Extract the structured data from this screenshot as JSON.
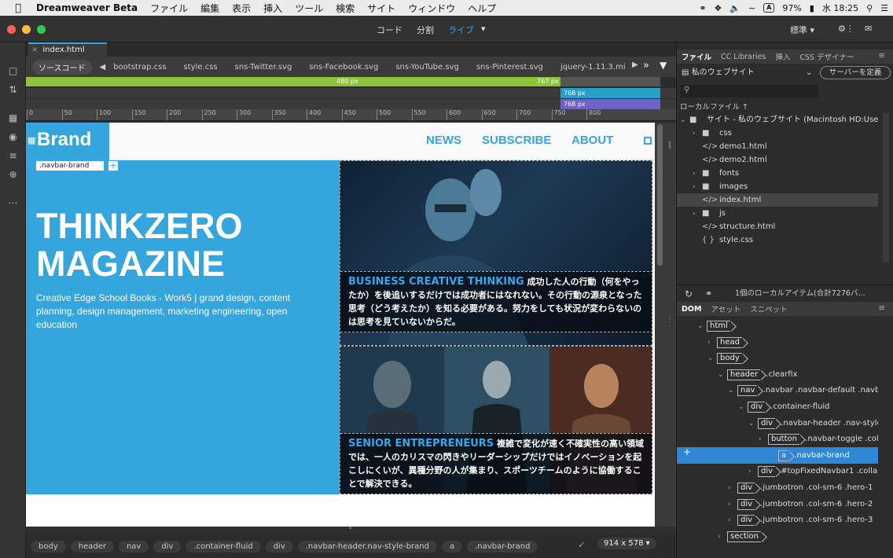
{
  "menubar": {
    "app": "Dreamweaver Beta",
    "items": [
      "ファイル",
      "編集",
      "表示",
      "挿入",
      "ツール",
      "検索",
      "サイト",
      "ウィンドウ",
      "ヘルプ"
    ],
    "battery": "97%",
    "clock": "水 18:25",
    "input_icon": "A"
  },
  "titlebar": {
    "views": [
      "コード",
      "分割",
      "ライブ"
    ],
    "workspace": "標準"
  },
  "doc": {
    "tab": "index.html"
  },
  "related": {
    "source": "ソースコード",
    "files": [
      "bootstrap.css",
      "style.css",
      "sns-Twitter.svg",
      "sns-Facebook.svg",
      "sns-YouTube.svg",
      "sns-Pinterest.svg",
      "jquery-1.11.3.mi"
    ]
  },
  "mq": {
    "a": "480",
    "a2": "767",
    "b": "768",
    "c": "768",
    "unit": "px"
  },
  "ruler": [
    "0",
    "50",
    "100",
    "150",
    "200",
    "250",
    "300",
    "350",
    "400",
    "450",
    "500",
    "550",
    "600",
    "650",
    "700",
    "750",
    "800"
  ],
  "page": {
    "brand": "Brand",
    "nav": [
      "NEWS",
      "SUBSCRIBE",
      "ABOUT"
    ],
    "selected_label": ".navbar-brand",
    "hero_title": "THINKZERO MAGAZINE",
    "hero_text": "Creative Edge School Books - Work5 | grand design, content planning, design management, marketing engineering, open education",
    "cap1_head": "BUSINESS CREATIVE THINKING",
    "cap1_body": "成功した人の行動（何をやったか）を後追いするだけでは成功者にはなれない。その行動の源泉となった思考（どう考えたか）を知る必要がある。努力をしても状況が変わらないのは思考を見ていないからだ。",
    "cap2_head": "SENIOR ENTREPRENEURS",
    "cap2_body": "複雑で変化が速く不確実性の高い領域では、一人のカリスマの閃きやリーダーシップだけではイノベーションを起こしにくいが、異種分野の人が集まり、スポーツチームのように協働することで解決できる。"
  },
  "status": {
    "crumbs": [
      "body",
      "header",
      "nav",
      "div",
      ".container-fluid",
      "div",
      ".navbar-header.nav-style-brand",
      "a",
      ".navbar-brand"
    ],
    "size": "914 x 578"
  },
  "files_panel": {
    "tabs": [
      "ファイル",
      "CC Libraries",
      "挿入",
      "CSS デザイナー"
    ],
    "site": "私のウェブサイト",
    "server_btn": "サーバーを定義",
    "local_label": "ローカルファイル ↑",
    "root": "サイト - 私のウェブサイト (Macintosh HD:Use...",
    "items": [
      {
        "name": "css",
        "type": "folder",
        "arrow": "›"
      },
      {
        "name": "demo1.html",
        "type": "html",
        "arrow": ""
      },
      {
        "name": "demo2.html",
        "type": "html",
        "arrow": ""
      },
      {
        "name": "fonts",
        "type": "folder",
        "arrow": "›"
      },
      {
        "name": "images",
        "type": "folder",
        "arrow": "›"
      },
      {
        "name": "index.html",
        "type": "html",
        "arrow": ""
      },
      {
        "name": "js",
        "type": "folder",
        "arrow": "›"
      },
      {
        "name": "structure.html",
        "type": "html",
        "arrow": ""
      },
      {
        "name": "style.css",
        "type": "css",
        "arrow": ""
      }
    ],
    "status": "1個のローカルアイテム(合計7276バ..."
  },
  "dom_panel": {
    "tabs": [
      "DOM",
      "アセット",
      "スニペット"
    ],
    "rows": [
      {
        "tag": "html",
        "cls": "",
        "indent": 0,
        "arrow": "⌄"
      },
      {
        "tag": "head",
        "cls": "",
        "indent": 1,
        "arrow": "›"
      },
      {
        "tag": "body",
        "cls": "",
        "indent": 1,
        "arrow": "⌄"
      },
      {
        "tag": "header",
        "cls": ".clearfix",
        "indent": 2,
        "arrow": "⌄"
      },
      {
        "tag": "nav",
        "cls": ".navbar .navbar-default .navba",
        "indent": 3,
        "arrow": "⌄"
      },
      {
        "tag": "div",
        "cls": ".container-fluid",
        "indent": 4,
        "arrow": "⌄"
      },
      {
        "tag": "div",
        "cls": ".navbar-header .nav-style",
        "indent": 5,
        "arrow": "⌄"
      },
      {
        "tag": "button",
        "cls": ".navbar-toggle .coll",
        "indent": 6,
        "arrow": "›"
      },
      {
        "tag": "a",
        "cls": ".navbar-brand",
        "indent": 7,
        "arrow": ""
      },
      {
        "tag": "div",
        "cls": "#topFixedNavbar1 .collaps",
        "indent": 5,
        "arrow": "›"
      },
      {
        "tag": "div",
        "cls": ".jumbotron .col-sm-6 .hero-1",
        "indent": 3,
        "arrow": "›"
      },
      {
        "tag": "div",
        "cls": ".jumbotron .col-sm-6 .hero-2",
        "indent": 3,
        "arrow": "›"
      },
      {
        "tag": "div",
        "cls": ".jumbotron .col-sm-6 .hero-3",
        "indent": 3,
        "arrow": "›"
      },
      {
        "tag": "section",
        "cls": "",
        "indent": 2,
        "arrow": "›"
      }
    ]
  },
  "colors": {
    "accent": "#37a6ea",
    "brand_blue": "#34a5dd",
    "mq_green": "#8ec43a",
    "mq_teal": "#27a0c7",
    "mq_purple": "#6e63c7"
  }
}
